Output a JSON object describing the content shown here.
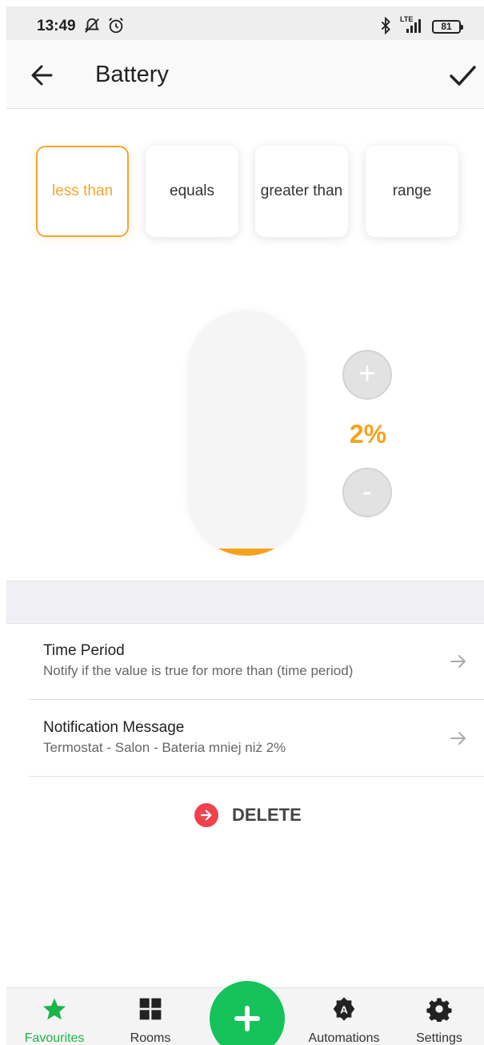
{
  "status_bar": {
    "time": "13:49",
    "network": "LTE",
    "battery_level": "81"
  },
  "app_bar": {
    "title": "Battery"
  },
  "conditions": [
    {
      "label": "less than",
      "active": true
    },
    {
      "label": "equals",
      "active": false
    },
    {
      "label": "greater than",
      "active": false
    },
    {
      "label": "range",
      "active": false
    }
  ],
  "slider": {
    "value_text": "2%",
    "value_percent": 2,
    "increment_label": "+",
    "decrement_label": "-"
  },
  "settings": [
    {
      "title": "Time Period",
      "subtitle": "Notify if the value is true for more than (time period)"
    },
    {
      "title": "Notification Message",
      "subtitle": "Termostat - Salon - Bateria  mniej niż 2%"
    }
  ],
  "delete_label": "DELETE",
  "bottom_nav": [
    {
      "label": "Favourites",
      "icon": "star-icon",
      "active": true
    },
    {
      "label": "Rooms",
      "icon": "grid-icon",
      "active": false
    },
    {
      "label": "Automations",
      "icon": "automation-icon",
      "active": false
    },
    {
      "label": "Settings",
      "icon": "gear-icon",
      "active": false
    }
  ],
  "colors": {
    "accent": "#f7a21b",
    "nav_active": "#1ab548",
    "fab": "#16c25a",
    "delete": "#f0424e"
  }
}
